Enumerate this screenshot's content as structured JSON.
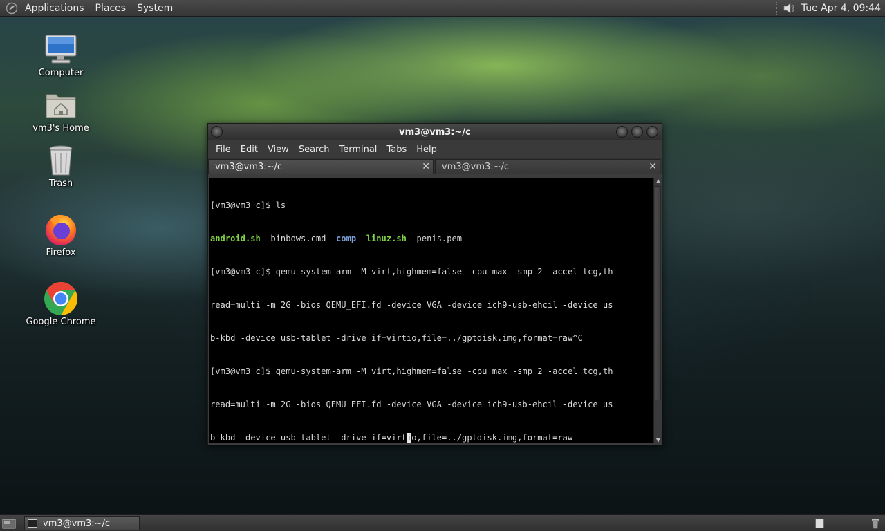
{
  "top_panel": {
    "menus": [
      "Applications",
      "Places",
      "System"
    ],
    "clock": "Tue Apr  4, 09:44",
    "icons": [
      "gnome-foot-icon",
      "volume-icon"
    ]
  },
  "desktop": {
    "icons": [
      {
        "label": "Computer",
        "icon": "computer-icon"
      },
      {
        "label": "vm3's Home",
        "icon": "home-folder-icon"
      },
      {
        "label": "Trash",
        "icon": "trash-icon"
      },
      {
        "label": "Firefox",
        "icon": "firefox-icon"
      },
      {
        "label": "Google Chrome",
        "icon": "chrome-icon"
      }
    ]
  },
  "terminal": {
    "title": "vm3@vm3:~/c",
    "menu": [
      "File",
      "Edit",
      "View",
      "Search",
      "Terminal",
      "Tabs",
      "Help"
    ],
    "tabs": [
      {
        "label": "vm3@vm3:~/c",
        "active": true
      },
      {
        "label": "vm3@vm3:~/c",
        "active": false
      }
    ],
    "lines": {
      "l1": "[vm3@vm3 c]$ ls",
      "l2a": "android.sh",
      "l2b": "  binbows.cmd  ",
      "l2c": "comp",
      "l2d": "  ",
      "l2e": "linuz.sh",
      "l2f": "  penis.pem",
      "l3": "[vm3@vm3 c]$ qemu-system-arm -M virt,highmem=false -cpu max -smp 2 -accel tcg,th",
      "l4": "read=multi -m 2G -bios QEMU_EFI.fd -device VGA -device ich9-usb-ehcil -device us",
      "l5": "b-kbd -device usb-tablet -drive if=virtio,file=../gptdisk.img,format=raw^C",
      "l6": "[vm3@vm3 c]$ qemu-system-arm -M virt,highmem=false -cpu max -smp 2 -accel tcg,th",
      "l7": "read=multi -m 2G -bios QEMU_EFI.fd -device VGA -device ich9-usb-ehcil -device us",
      "l8a": "b-kbd -device usb-tablet -drive if=virt",
      "l8b": "i",
      "l8c": "o,file=../gptdisk.img,format=raw"
    }
  },
  "bottom_panel": {
    "task": "vm3@vm3:~/c"
  },
  "colors": {
    "green_exec": "#7fd043",
    "blue_dir": "#7b9fd6",
    "term_bg": "#000000"
  }
}
